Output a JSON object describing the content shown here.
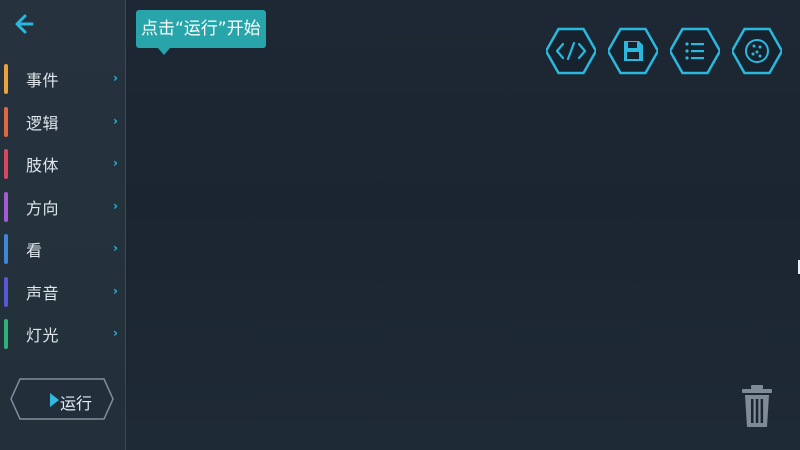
{
  "sidebar": {
    "categories": [
      {
        "label": "事件",
        "color": "#e8a33a"
      },
      {
        "label": "逻辑",
        "color": "#e0673e"
      },
      {
        "label": "肢体",
        "color": "#d8475e"
      },
      {
        "label": "方向",
        "color": "#a35ad4"
      },
      {
        "label": "看",
        "color": "#3f86d6"
      },
      {
        "label": "声音",
        "color": "#5a57d8"
      },
      {
        "label": "灯光",
        "color": "#2fb07c"
      }
    ],
    "chevron": "›",
    "run_label": "运行"
  },
  "canvas": {
    "tooltip": "点击“运行”开始"
  },
  "toolbar": {
    "icons": [
      "code-icon",
      "save-icon",
      "list-icon",
      "palette-icon"
    ]
  },
  "colors": {
    "accent": "#2ab8de",
    "tooltip_bg": "#27a5aa",
    "background": "#1b2631"
  }
}
